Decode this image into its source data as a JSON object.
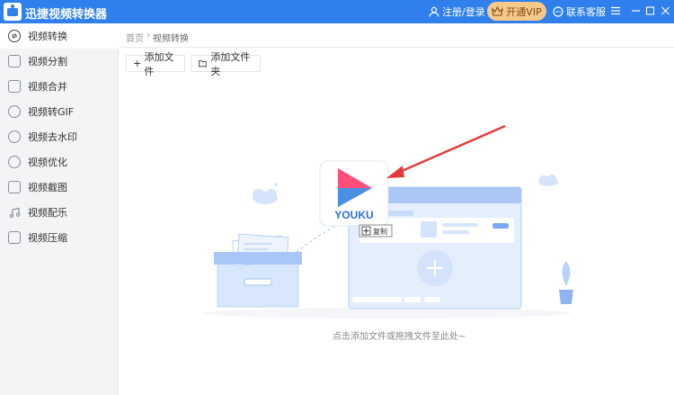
{
  "app": {
    "title": "迅捷视频转换器"
  },
  "titlebar": {
    "login": "注册/登录",
    "vip": "开通VIP",
    "service": "联系客服",
    "icons": {
      "user": "user-icon",
      "crown": "crown-icon",
      "chat": "chat-icon",
      "menu": "menu-icon",
      "minimize": "minimize-icon",
      "maximize": "maximize-icon",
      "close": "close-icon"
    }
  },
  "colors": {
    "accent": "#2f80ed",
    "vip_bg": "#f6c88a",
    "sidebar_bg": "#f3f4f6",
    "illustration": "#cfe0fa",
    "arrow": "#e23b3b"
  },
  "sidebar": {
    "items": [
      {
        "label": "视频转换",
        "icon": "convert-icon",
        "active": true
      },
      {
        "label": "视频分割",
        "icon": "split-icon"
      },
      {
        "label": "视频合并",
        "icon": "merge-icon"
      },
      {
        "label": "视频转GIF",
        "icon": "gif-icon"
      },
      {
        "label": "视频去水印",
        "icon": "watermark-icon"
      },
      {
        "label": "视频优化",
        "icon": "optimize-icon"
      },
      {
        "label": "视频截图",
        "icon": "screenshot-icon"
      },
      {
        "label": "视频配乐",
        "icon": "music-icon"
      },
      {
        "label": "视频压缩",
        "icon": "compress-icon"
      }
    ]
  },
  "breadcrumb": {
    "home": "首页",
    "separator": "›",
    "current": "视频转换"
  },
  "toolbar": {
    "add_file": "添加文件",
    "add_folder": "添加文件夹"
  },
  "drop_area": {
    "hint": "点击添加文件或拖拽文件至此处~",
    "drag_badge": "复制",
    "dragged_logo": "YOUKU"
  }
}
